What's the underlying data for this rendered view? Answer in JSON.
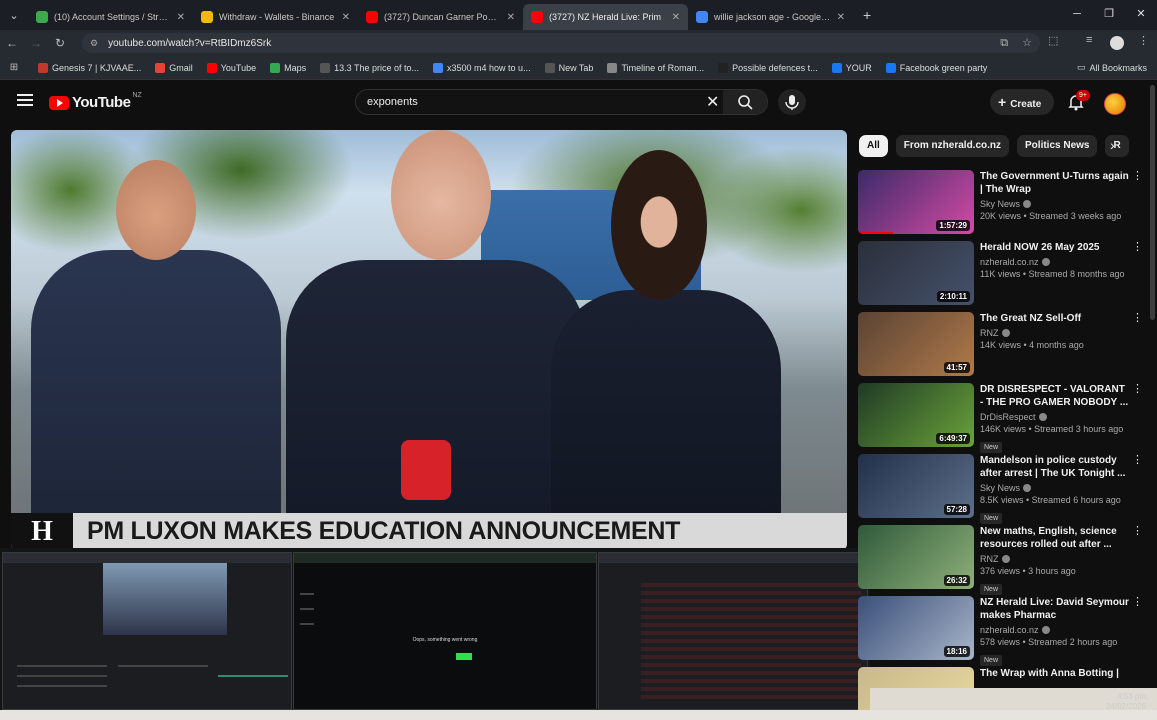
{
  "browser": {
    "tabs": [
      {
        "title": "(10) Account Settings / Streami",
        "icon_color": "#3fa84a",
        "icon": "streamlabs-icon"
      },
      {
        "title": "Withdraw - Wallets - Binance",
        "icon_color": "#f0b90b",
        "icon": "binance-icon"
      },
      {
        "title": "(3727) Duncan Garner Podcast",
        "icon_color": "#ff0000",
        "icon": "youtube-icon"
      },
      {
        "title": "(3727) NZ Herald Live: Prim",
        "icon_color": "#ff0000",
        "icon": "youtube-icon"
      },
      {
        "title": "willie jackson age - Google Sea",
        "icon_color": "#4285f4",
        "icon": "google-icon"
      }
    ],
    "url": "youtube.com/watch?v=RtBIDmz6Srk",
    "bookmarks": [
      {
        "label": "Genesis 7 | KJVAAE...",
        "color": "#c0392b"
      },
      {
        "label": "Gmail",
        "color": "#ea4335"
      },
      {
        "label": "YouTube",
        "color": "#ff0000"
      },
      {
        "label": "Maps",
        "color": "#34a853"
      },
      {
        "label": "13.3 The price of to...",
        "color": "#555"
      },
      {
        "label": "x3500 m4 how to u...",
        "color": "#4285f4"
      },
      {
        "label": "New Tab",
        "color": "#555"
      },
      {
        "label": "Timeline of Roman...",
        "color": "#888"
      },
      {
        "label": "Possible defences t...",
        "color": "#222"
      },
      {
        "label": "YOUR",
        "color": "#1877f2"
      },
      {
        "label": "Facebook green party",
        "color": "#1877f2"
      }
    ],
    "all_bookmarks": "All Bookmarks"
  },
  "youtube": {
    "logo": "YouTube",
    "country": "NZ",
    "search_query": "exponents",
    "create_label": "Create",
    "notifications": "9+",
    "caption_mark": "H",
    "video_caption": "PM LUXON MAKES EDUCATION ANNOUNCEMENT",
    "chips": [
      "All",
      "From nzherald.co.nz",
      "Politics News",
      "R"
    ],
    "recommendations": [
      {
        "title": "The Government U-Turns again | The Wrap",
        "channel": "Sky News",
        "views": "20K views • Streamed 3 weeks ago",
        "duration": "1:57:29",
        "thumb": [
          "#3a2a6a",
          "#d54aa3"
        ],
        "new": "",
        "progress": 0.3
      },
      {
        "title": "Herald NOW 26 May 2025",
        "channel": "nzherald.co.nz",
        "views": "11K views • Streamed 8 months ago",
        "duration": "2:10:11",
        "thumb": [
          "#2a2f3a",
          "#45516b"
        ],
        "new": "",
        "progress": 0
      },
      {
        "title": "The Great NZ Sell-Off",
        "channel": "RNZ",
        "views": "14K views • 4 months ago",
        "duration": "41:57",
        "thumb": [
          "#5a4334",
          "#b07a4a"
        ],
        "new": "",
        "progress": 0
      },
      {
        "title": "DR DISRESPECT - VALORANT - THE PRO GAMER NOBODY ...",
        "channel": "DrDisRespect",
        "views": "146K views • Streamed 3 hours ago",
        "duration": "6:49:37",
        "thumb": [
          "#1f3a25",
          "#6aa33a"
        ],
        "new": "New",
        "progress": 0
      },
      {
        "title": "Mandelson in police custody after arrest | The UK Tonight ...",
        "channel": "Sky News",
        "views": "8.5K views • Streamed 6 hours ago",
        "duration": "57:28",
        "thumb": [
          "#22304a",
          "#5d6f8a"
        ],
        "new": "New",
        "progress": 0
      },
      {
        "title": "New maths, English, science resources rolled out after ...",
        "channel": "RNZ",
        "views": "376 views • 3 hours ago",
        "duration": "26:32",
        "thumb": [
          "#2f5a3a",
          "#8fb07a"
        ],
        "new": "New",
        "progress": 0
      },
      {
        "title": "NZ Herald Live: David Seymour makes Pharmac announcement",
        "channel": "nzherald.co.nz",
        "views": "578 views • Streamed 2 hours ago",
        "duration": "18:16",
        "thumb": [
          "#3a4f7a",
          "#a9b6c9"
        ],
        "new": "New",
        "progress": 0
      },
      {
        "title": "The Wrap with Anna Botting |",
        "channel": "",
        "views": "",
        "duration": "",
        "thumb": [
          "#c9b98a",
          "#e9d9a0"
        ],
        "new": "",
        "progress": 0
      }
    ]
  },
  "previews": {
    "error_text": "Oops, something went wrong"
  },
  "taskbar": {
    "time": "4:53 pm",
    "date": "24/02/2026"
  }
}
